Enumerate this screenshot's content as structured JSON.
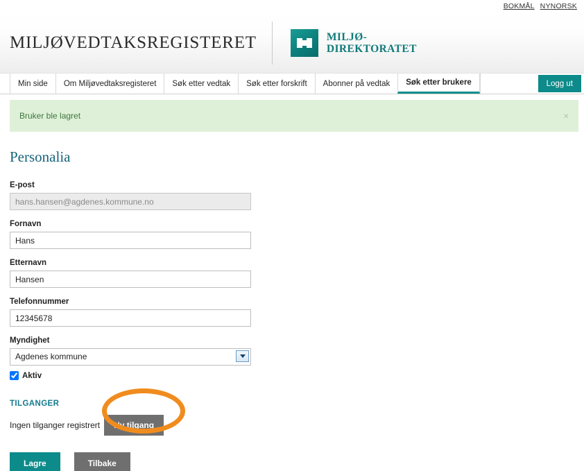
{
  "lang_bar": {
    "links": [
      {
        "label": "BOKMÅL"
      },
      {
        "label": "NYNORSK"
      }
    ]
  },
  "header": {
    "site_title": "MILJØVEDTAKSREGISTERET",
    "brand_line1": "MILJØ-",
    "brand_line2": "DIREKTORATET",
    "brand_icon": "book-logo-icon",
    "accent_color": "#0d8a8a"
  },
  "nav": {
    "items": [
      {
        "label": "Min side",
        "active": false
      },
      {
        "label": "Om Miljøvedtaksregisteret",
        "active": false
      },
      {
        "label": "Søk etter vedtak",
        "active": false
      },
      {
        "label": "Søk etter forskrift",
        "active": false
      },
      {
        "label": "Abonner på vedtak",
        "active": false
      },
      {
        "label": "Søk etter brukere",
        "active": true
      }
    ],
    "logout_label": "Logg ut"
  },
  "alert": {
    "message": "Bruker ble lagret",
    "close_icon": "×",
    "background_color": "#dff0d8",
    "text_color": "#3c763d"
  },
  "form": {
    "heading": "Personalia",
    "fields": [
      {
        "label": "E-post",
        "value": "hans.hansen@agdenes.kommune.no",
        "placeholder": "",
        "disabled": true
      },
      {
        "label": "Fornavn",
        "value": "Hans",
        "placeholder": "",
        "disabled": false
      },
      {
        "label": "Etternavn",
        "value": "Hansen",
        "placeholder": "",
        "disabled": false
      },
      {
        "label": "Telefonnummer",
        "value": "12345678",
        "placeholder": "",
        "disabled": false
      }
    ],
    "select": {
      "label": "Myndighet",
      "value": "Agdenes kommune",
      "arrow_icon": "chevron-down-icon"
    },
    "checkbox": {
      "label": "Aktiv",
      "checked": true
    }
  },
  "tilganger": {
    "title": "TILGANGER",
    "empty_text": "Ingen tilganger registrert",
    "new_button_label": "Ny tilgang",
    "annotation_color": "#f08c1e"
  },
  "actions": {
    "save_label": "Lagre",
    "back_label": "Tilbake"
  }
}
